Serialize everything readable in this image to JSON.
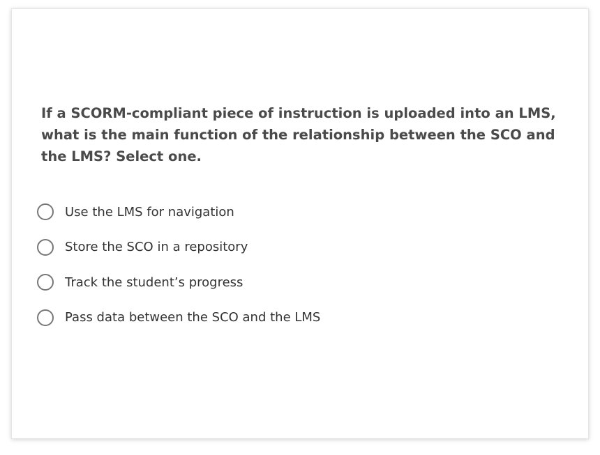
{
  "quiz": {
    "question": "If a SCORM-compliant piece of instruction is uploaded into an LMS, what is the main function of the relationship between the SCO and the LMS? Select one.",
    "options": [
      {
        "label": "Use the LMS for navigation",
        "selected": false
      },
      {
        "label": "Store the SCO in a repository",
        "selected": false
      },
      {
        "label": "Track the student’s progress",
        "selected": false
      },
      {
        "label": "Pass data between the SCO and the LMS",
        "selected": false
      }
    ]
  },
  "colors": {
    "question_text": "#4a4a4a",
    "option_text": "#333333",
    "radio_border": "#777777",
    "card_background": "#ffffff"
  }
}
